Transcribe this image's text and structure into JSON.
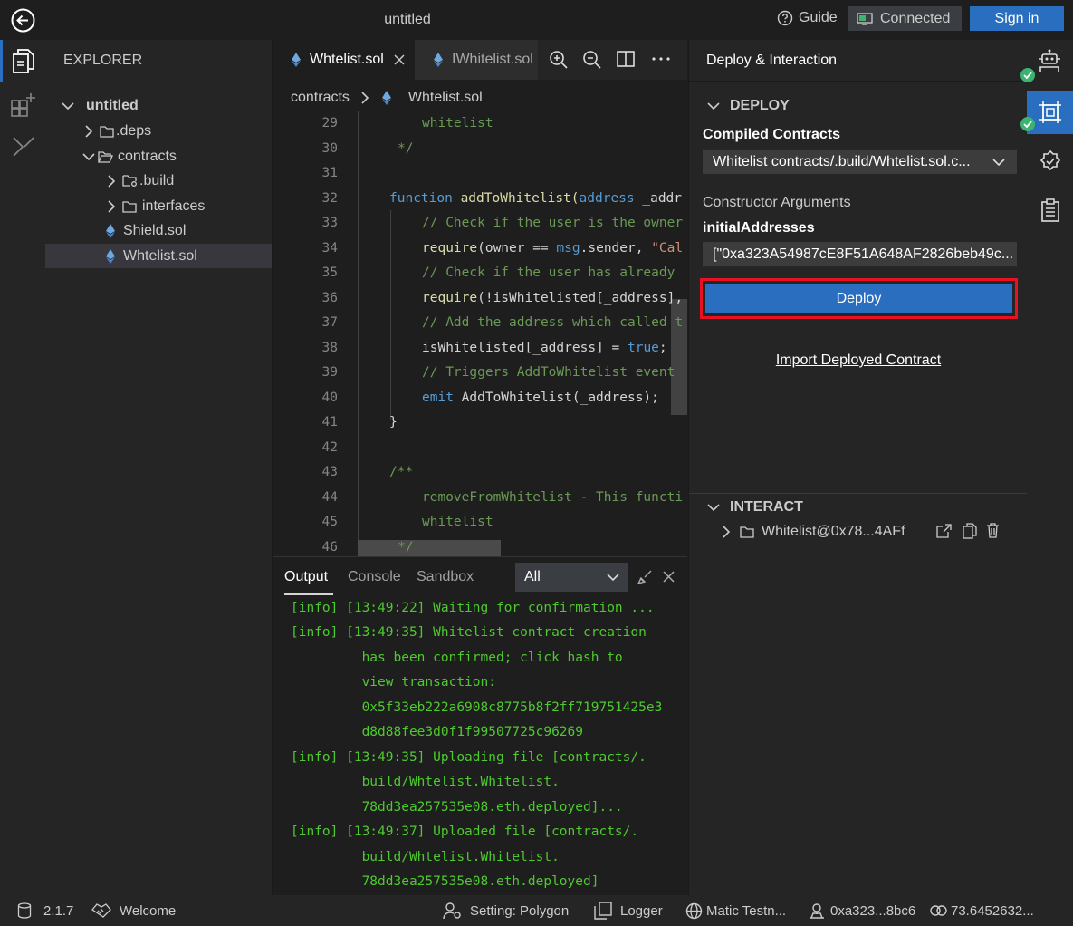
{
  "window": {
    "title": "untitled",
    "guide_label": "Guide",
    "connected_label": "Connected",
    "signin_label": "Sign in"
  },
  "explorer": {
    "header": "EXPLORER",
    "root": "untitled",
    "items": [
      {
        "label": ".deps",
        "type": "folder"
      },
      {
        "label": "contracts",
        "type": "folder-open"
      },
      {
        "label": ".build",
        "type": "folder"
      },
      {
        "label": "interfaces",
        "type": "folder"
      },
      {
        "label": "Shield.sol",
        "type": "file"
      },
      {
        "label": "Whtelist.sol",
        "type": "file"
      }
    ]
  },
  "editor": {
    "tabs": [
      {
        "label": "Whtelist.sol"
      },
      {
        "label": "IWhitelist.sol"
      }
    ],
    "breadcrumb": {
      "folder": "contracts",
      "file": "Whtelist.sol"
    },
    "line_numbers": [
      "29",
      "30",
      "31",
      "32",
      "33",
      "34",
      "35",
      "36",
      "37",
      "38",
      "39",
      "40",
      "41",
      "42",
      "43",
      "44",
      "45",
      "46"
    ],
    "code": {
      "l29": "whitelist",
      "l30": "*/",
      "l32_kw": "function",
      "l32_fn": " addToWhitelist(",
      "l32_type": "address",
      "l32_rest": " _addr",
      "l33": "// Check if the user is the owner",
      "l34_fn": "require",
      "l34_mid": "(owner == ",
      "l34_kw": "msg",
      "l34_mid2": ".sender, ",
      "l34_str": "\"Cal",
      "l35": "// Check if the user has already",
      "l36_fn": "require",
      "l36_rest": "(!isWhitelisted[_address],",
      "l37": "// Add the address which called t",
      "l38_rest": "isWhitelisted[_address] = ",
      "l38_kw": "true",
      "l38_end": ";",
      "l39": "// Triggers AddToWhitelist event",
      "l40_kw": "emit",
      "l40_rest": " AddToWhitelist(_address);",
      "l41": "}",
      "l43": "/**",
      "l44": "removeFromWhitelist - This functi",
      "l45": "whitelist",
      "l46": "*/"
    }
  },
  "panel": {
    "tabs": {
      "output": "Output",
      "console": "Console",
      "sandbox": "Sandbox"
    },
    "filter": "All",
    "lines": [
      "[info] [13:49:22] Waiting for confirmation ...",
      "[info] [13:49:35] Whitelist contract creation",
      "         has been confirmed; click hash to",
      "         view transaction:",
      "         0x5f33eb222a6908c8775b8f2ff719751425e3",
      "         d8d88fee3d0f1f99507725c96269",
      "[info] [13:49:35] Uploading file [contracts/.",
      "         build/Whtelist.Whitelist.",
      "         78dd3ea257535e08.eth.deployed]...",
      "[info] [13:49:37] Uploaded file [contracts/.",
      "         build/Whtelist.Whitelist.",
      "         78dd3ea257535e08.eth.deployed]"
    ]
  },
  "deploy_panel": {
    "title": "Deploy & Interaction",
    "deploy_section": "DEPLOY",
    "compiled_label": "Compiled Contracts",
    "compiled_value": "Whitelist contracts/.build/Whtelist.sol.c...",
    "ctor_label": "Constructor Arguments",
    "arg_name": "initialAddresses",
    "arg_value": "[\"0xa323A54987cE8F51A648AF2826beb49c...",
    "deploy_button": "Deploy",
    "import_link": "Import Deployed Contract",
    "interact_section": "INTERACT",
    "contract_instance": "Whitelist@0x78...4AFf"
  },
  "statusbar": {
    "version": "2.1.7",
    "welcome": "Welcome",
    "setting": "Setting: Polygon",
    "logger": "Logger",
    "network": "Matic Testn...",
    "account": "0xa323...8bc6",
    "balance": "73.6452632..."
  },
  "colors": {
    "accent": "#2a6ebf",
    "highlight_border": "#e81123",
    "success": "#3cb371",
    "output_text": "#4ec92f"
  }
}
